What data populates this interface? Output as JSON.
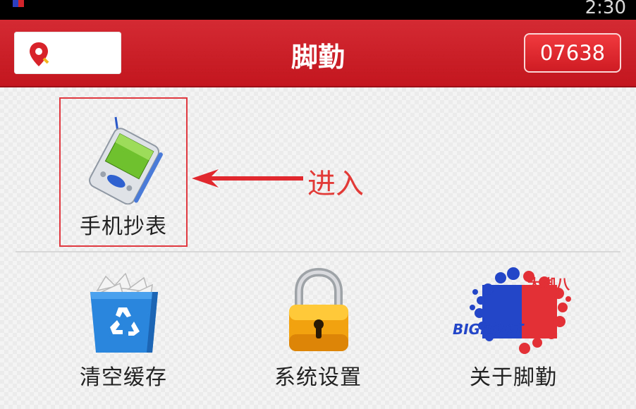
{
  "status_bar": {
    "time": "2:30"
  },
  "header": {
    "title": "脚勤",
    "code": "07638",
    "location_icon": "location-pin-icon"
  },
  "menu": {
    "row1": [
      {
        "label": "手机抄表",
        "icon": "handheld-device-icon"
      }
    ],
    "row2": [
      {
        "label": "清空缓存",
        "icon": "recycle-bin-icon"
      },
      {
        "label": "系统设置",
        "icon": "padlock-icon"
      },
      {
        "label": "关于脚勤",
        "icon": "bigfoot-logo",
        "logo_text": [
          "大脚八",
          "BIGFOOT"
        ]
      }
    ]
  },
  "annotation": {
    "text": "进入",
    "color": "#e23a36"
  },
  "colors": {
    "title_bar": "#c9202a",
    "accent": "#e0393f"
  }
}
